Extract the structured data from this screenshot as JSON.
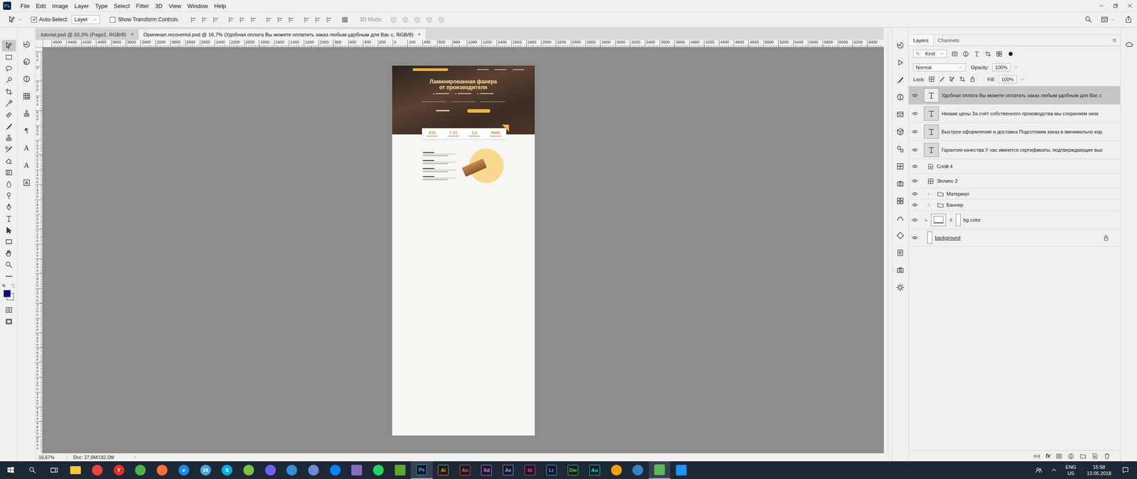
{
  "app": {
    "logo": "Ps"
  },
  "menu": [
    "File",
    "Edit",
    "Image",
    "Layer",
    "Type",
    "Select",
    "Filter",
    "3D",
    "View",
    "Window",
    "Help"
  ],
  "options": {
    "auto_select": {
      "label": "Auto-Select:",
      "checked": true
    },
    "target": "Layer",
    "transform_controls": {
      "label": "Show Transform Controls",
      "checked": false
    },
    "mode3d": {
      "label": "3D Mode:",
      "disabled": true
    }
  },
  "tabs": [
    {
      "label": "tutorial.psd @ 33,3% (Page2, RGB/8)",
      "close": "×",
      "selected": false
    },
    {
      "label": "Оригинал.recovered.psd @ 16,7% (Удобная оплата Вы можете оплатить заказ любым удобным для Вас с, RGB/8)",
      "close": "×",
      "selected": true
    }
  ],
  "rulers": {
    "horizontal": [
      "4600",
      "4400",
      "4200",
      "4000",
      "3800",
      "3600",
      "3400",
      "3200",
      "3000",
      "2800",
      "2600",
      "2400",
      "2200",
      "2000",
      "1800",
      "1600",
      "1400",
      "1200",
      "1000",
      "800",
      "600",
      "400",
      "200",
      "0",
      "200",
      "400",
      "600",
      "800",
      "1000",
      "1200",
      "1400",
      "1600",
      "1800",
      "2000",
      "2200",
      "2400",
      "2600",
      "2800",
      "3000",
      "3200",
      "3400",
      "3600",
      "3800",
      "4000",
      "4200",
      "4400",
      "4600",
      "4800",
      "5000",
      "5200",
      "5400",
      "5600",
      "5800",
      "6000",
      "6200",
      "6400"
    ],
    "vertical": [
      "200",
      "0",
      "200",
      "400",
      "600",
      "800",
      "1000",
      "1200",
      "1400",
      "1600",
      "1800",
      "2000",
      "2200",
      "2400",
      "2600",
      "2800",
      "3000",
      "3200",
      "3400",
      "3600",
      "3800",
      "4000",
      "4200",
      "4400",
      "4600",
      "4800",
      "5000"
    ]
  },
  "tools": [
    {
      "kind": "move",
      "selected": true
    },
    {
      "kind": "marquee",
      "selected": false
    },
    {
      "kind": "lasso",
      "selected": false
    },
    {
      "kind": "quick-select",
      "selected": false
    },
    {
      "kind": "crop",
      "selected": false
    },
    {
      "kind": "eyedropper",
      "selected": false
    },
    {
      "kind": "healing",
      "selected": false
    },
    {
      "kind": "brush",
      "selected": false
    },
    {
      "kind": "stamp",
      "selected": false
    },
    {
      "kind": "history-brush",
      "selected": false
    },
    {
      "kind": "eraser",
      "selected": false
    },
    {
      "kind": "gradient",
      "selected": false
    },
    {
      "kind": "blur",
      "selected": false
    },
    {
      "kind": "dodge",
      "selected": false
    },
    {
      "kind": "pen",
      "selected": false
    },
    {
      "kind": "type",
      "selected": false
    },
    {
      "kind": "path-select",
      "selected": false
    },
    {
      "kind": "rectangle",
      "selected": false
    },
    {
      "kind": "hand",
      "selected": false
    },
    {
      "kind": "zoom",
      "selected": false
    },
    {
      "kind": "more",
      "selected": false
    }
  ],
  "colors": {
    "foreground": "#0a0a8c",
    "background": "#ffffff"
  },
  "tools2": [
    {
      "kind": "history"
    },
    {
      "kind": "brush-preset"
    },
    {
      "kind": "adjust"
    },
    {
      "kind": "table"
    },
    {
      "kind": "clone-source"
    },
    {
      "kind": "glyph",
      "label": "¶"
    },
    {
      "kind": "glyph",
      "label": "A"
    },
    {
      "kind": "glyph",
      "label": "A"
    },
    {
      "kind": "glyphs"
    }
  ],
  "document": {
    "title": [
      "Ламинированная фанера",
      "от производителя"
    ],
    "stats": [
      "610",
      "7-12",
      "1,1",
      "6000"
    ]
  },
  "status": {
    "zoom": "16,67%",
    "doc": "Doc: 27,9M/182,0M"
  },
  "panel_strip": [
    {
      "kind": "history"
    },
    {
      "kind": "play"
    },
    {
      "kind": "brush"
    },
    {
      "kind": "adjust"
    },
    {
      "kind": "library"
    },
    {
      "kind": "cube"
    },
    {
      "kind": "shapes"
    },
    {
      "kind": "styles"
    },
    {
      "kind": "camera"
    },
    {
      "kind": "swatch"
    },
    {
      "kind": "paths"
    },
    {
      "kind": "diamond"
    },
    {
      "kind": "notes"
    },
    {
      "kind": "camera"
    },
    {
      "kind": "gear"
    }
  ],
  "layers_panel": {
    "tabs": [
      {
        "label": "Layers",
        "selected": true
      },
      {
        "label": "Channels",
        "selected": false
      }
    ],
    "filter": "Kind",
    "blend": "Normal",
    "opacity_label": "Opacity:",
    "opacity": "100%",
    "lock_label": "Lock:",
    "fill_label": "Fill:",
    "fill": "100%",
    "footer_fx": "fx",
    "layers": [
      {
        "name": "Удобная оплата Вы можете оплатить заказ любым удобным для Вас с",
        "kind": "text",
        "visible": true,
        "selected": true
      },
      {
        "name": "Низкие цены За счёт собственного производства мы сохраняем низк",
        "kind": "text",
        "visible": true,
        "selected": false
      },
      {
        "name": "Быстрое оформление и доставка Подготовим заказ в минимально кор",
        "kind": "text",
        "visible": true,
        "selected": false
      },
      {
        "name": "Гарантия качества У нас имеются сертификаты, подтверждающие выс",
        "kind": "text",
        "visible": true,
        "selected": false
      },
      {
        "name": "Слой 4",
        "kind": "smart",
        "visible": true,
        "selected": false
      },
      {
        "name": "Эллипс 2",
        "kind": "shape",
        "visible": true,
        "selected": false
      },
      {
        "name": "Материал",
        "kind": "group",
        "visible": true,
        "selected": false,
        "expanded": false
      },
      {
        "name": "Баннер",
        "kind": "group",
        "visible": true,
        "selected": false,
        "expanded": false
      },
      {
        "name": "bg color",
        "kind": "masked",
        "visible": true,
        "selected": false
      },
      {
        "name": "background",
        "kind": "background",
        "visible": true,
        "selected": false,
        "locked": true
      }
    ]
  },
  "taskbar": {
    "apps": [
      {
        "kind": "folder",
        "color": "#f4c542",
        "active": false
      },
      {
        "kind": "circle",
        "color": "#e8453c",
        "active": false
      },
      {
        "kind": "letter-circle",
        "label": "Y",
        "color": "#e0302a",
        "active": false
      },
      {
        "kind": "circle",
        "color": "#4caf50",
        "active": false
      },
      {
        "kind": "circle",
        "color": "#ff7139",
        "active": false
      },
      {
        "kind": "letter-circle",
        "label": "e",
        "color": "#1e88e5",
        "active": false
      },
      {
        "kind": "letter-circle",
        "label": "24",
        "color": "#4aa3df",
        "active": false
      },
      {
        "kind": "letter-circle",
        "label": "S",
        "color": "#00aff0",
        "active": false
      },
      {
        "kind": "circle",
        "color": "#7cc242",
        "active": false
      },
      {
        "kind": "circle",
        "color": "#7360f2",
        "active": false
      },
      {
        "kind": "circle",
        "color": "#3390d6",
        "active": false
      },
      {
        "kind": "circle",
        "color": "#7289da",
        "active": false
      },
      {
        "kind": "circle",
        "color": "#0084ff",
        "active": false
      },
      {
        "kind": "square",
        "color": "#8a6bbf",
        "active": false
      },
      {
        "kind": "circle",
        "color": "#25d366",
        "active": false
      },
      {
        "kind": "square",
        "color": "#5aa832",
        "active": false
      },
      {
        "kind": "letter-square",
        "label": "Ps",
        "color": "#31a8ff",
        "active": true
      },
      {
        "kind": "letter-square",
        "label": "Ai",
        "color": "#ff9a00",
        "active": false
      },
      {
        "kind": "letter-square",
        "label": "An",
        "color": "#ff5a36",
        "active": false
      },
      {
        "kind": "letter-square",
        "label": "Xd",
        "color": "#ff61f6",
        "active": false
      },
      {
        "kind": "letter-square",
        "label": "Ae",
        "color": "#9999ff",
        "active": false
      },
      {
        "kind": "letter-square",
        "label": "Id",
        "color": "#ff3f7f",
        "active": false
      },
      {
        "kind": "letter-square",
        "label": "Lr",
        "color": "#4da6ff",
        "active": false
      },
      {
        "kind": "letter-square",
        "label": "Dw",
        "color": "#4cd137",
        "active": false
      },
      {
        "kind": "letter-square",
        "label": "Au",
        "color": "#00e4bb",
        "active": false
      },
      {
        "kind": "circle",
        "color": "#f39c12",
        "active": false
      },
      {
        "kind": "circle",
        "color": "#3b82c4",
        "active": false
      },
      {
        "kind": "square",
        "color": "#5cb85c",
        "active": true
      },
      {
        "kind": "square",
        "color": "#1e90ff",
        "active": false
      }
    ],
    "tray": {
      "lang": "ENG",
      "layout": "US",
      "time": "15:58",
      "date": "13.05.2018"
    }
  }
}
